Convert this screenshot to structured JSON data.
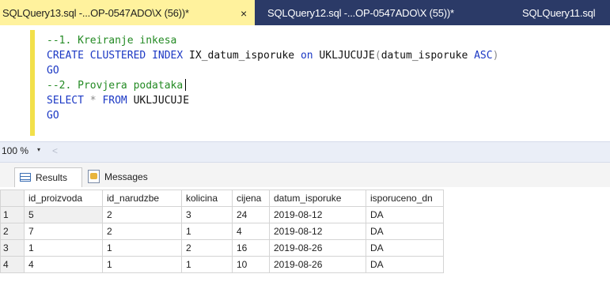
{
  "tabs": [
    {
      "label": "SQLQuery13.sql -...OP-0547ADO\\X (56))*",
      "close": "×"
    },
    {
      "label": "SQLQuery12.sql -...OP-0547ADO\\X (55))*"
    },
    {
      "label": "SQLQuery11.sql"
    }
  ],
  "editor": {
    "line1": "--1. Kreiranje inkesa",
    "line2": {
      "kw1": "CREATE",
      "kw2": "CLUSTERED",
      "kw3": "INDEX",
      "name": "IX_datum_isporuke",
      "kw4": "on",
      "table": "UKLJUCUJE",
      "open": "(",
      "col": "datum_isporuke",
      "kw5": "ASC",
      "close": ")"
    },
    "line3": "GO",
    "line4": "--2. Provjera podataka",
    "line5": {
      "kw1": "SELECT",
      "star": "*",
      "kw2": "FROM",
      "table": "UKLJUCUJE"
    },
    "line6": "GO"
  },
  "zoombar": {
    "zoom": "100 %",
    "dropdown": "▾",
    "scroll_left": "<"
  },
  "result_tabs": {
    "results": "Results",
    "messages": "Messages"
  },
  "grid": {
    "columns": [
      "id_proizvoda",
      "id_narudzbe",
      "kolicina",
      "cijena",
      "datum_isporuke",
      "isporuceno_dn"
    ],
    "rows": [
      {
        "n": "1",
        "cells": [
          "5",
          "2",
          "3",
          "24",
          "2019-08-12",
          "DA"
        ]
      },
      {
        "n": "2",
        "cells": [
          "7",
          "2",
          "1",
          "4",
          "2019-08-12",
          "DA"
        ]
      },
      {
        "n": "3",
        "cells": [
          "1",
          "1",
          "2",
          "16",
          "2019-08-26",
          "DA"
        ]
      },
      {
        "n": "4",
        "cells": [
          "4",
          "1",
          "1",
          "10",
          "2019-08-26",
          "DA"
        ]
      }
    ]
  }
}
